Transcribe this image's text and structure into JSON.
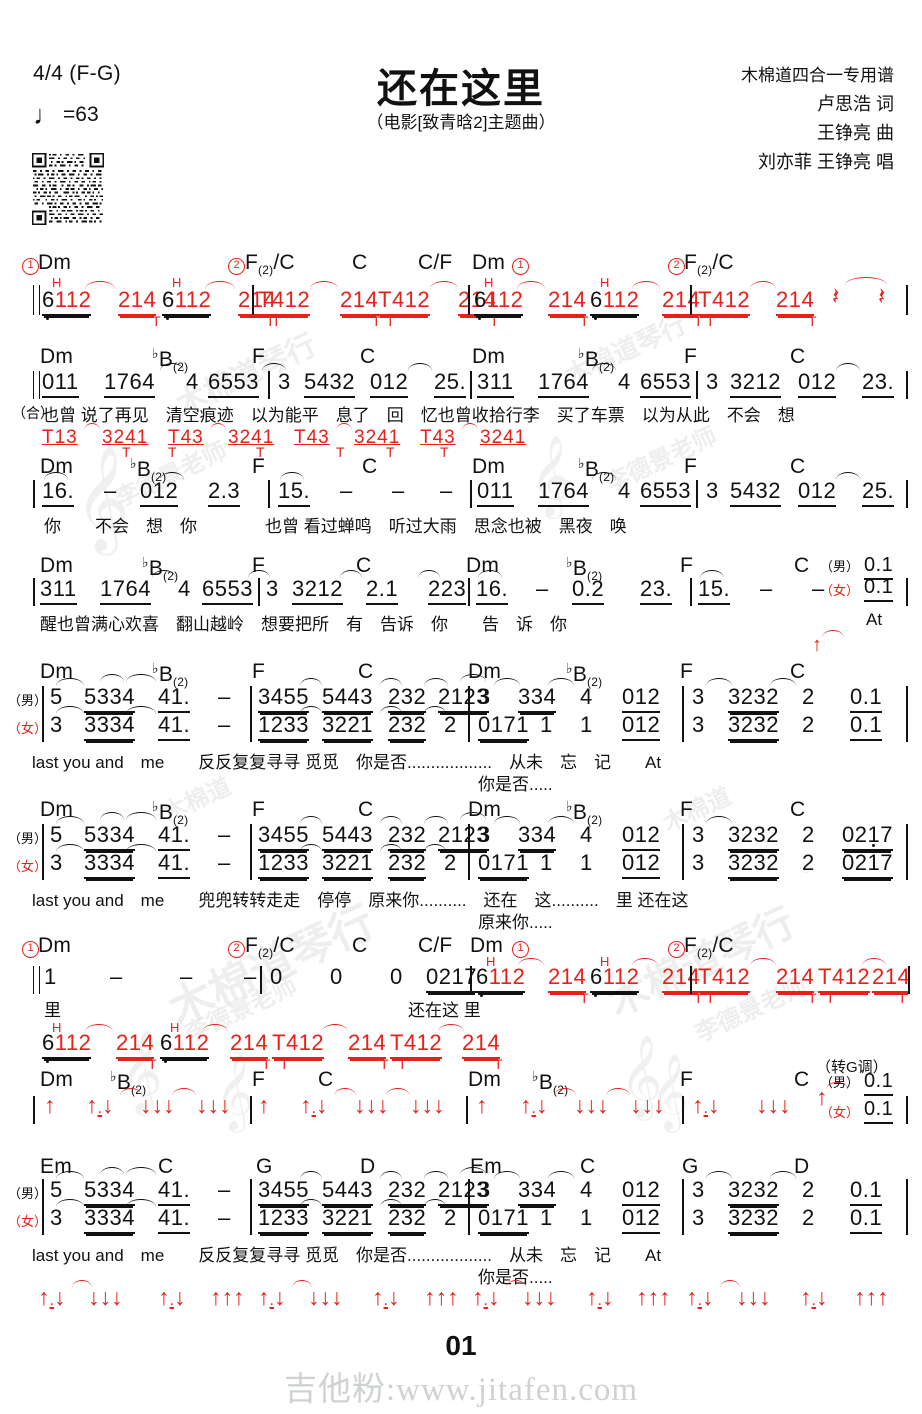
{
  "header": {
    "meter": "4/4 (F-G)",
    "tempo_note": "♩",
    "tempo": "=63",
    "title": "还在这里",
    "subtitle": "（电影[致青晗2]主题曲）",
    "publisher": "木棉道四合一专用谱",
    "lyricist": "卢思浩 词",
    "composer": "王铮亮 曲",
    "singers": "刘亦菲 王铮亮 唱",
    "qr_name": "qr-code"
  },
  "colors": {
    "red": "#e8201a",
    "black": "#111111",
    "watermark": "#d8dcd8"
  },
  "page_number": "01",
  "site_watermark": "吉他粉:www.jitafen.com",
  "watermarks": [
    "木棉道琴行",
    "李德景老师"
  ],
  "labels": {
    "male": "（男）",
    "female": "（女）",
    "together": "（合）",
    "modulate": "（转G调）",
    "ending1": "1",
    "ending2": "2"
  },
  "systems": [
    {
      "id": "intro-1",
      "kind": "tab",
      "chords": [
        "Dm",
        "F(2)/C",
        "C",
        "C/F",
        "Dm",
        "F(2)/C"
      ],
      "tab_cells": [
        "6112",
        "214",
        "6112",
        "214",
        "T412",
        "214",
        "T412",
        "214",
        "6112",
        "214",
        "6112",
        "214",
        "T412",
        "214"
      ],
      "thumb_marks": [
        "T"
      ],
      "hammer_marks": [
        "H"
      ],
      "rests": [
        "⸺",
        "⸺"
      ]
    },
    {
      "id": "verse-1",
      "kind": "melody",
      "chords": [
        "Dm",
        "♭B(2)",
        "F",
        "C",
        "Dm",
        "♭B(2)",
        "F",
        "C"
      ],
      "notes": [
        "011",
        "1764",
        "4",
        "6553",
        "3",
        "5432",
        "012",
        "25.",
        "311",
        "1764",
        "4",
        "6553",
        "3",
        "3212",
        "012",
        "23."
      ],
      "lyrics": "也曾 说了再见　清空痕迹　以为能平　息了　回　忆也曾收拾行李　买了车票　以为从此　不会　想",
      "lyric_prefix": "（合）",
      "fingering": [
        "T13",
        "3241",
        "T43",
        "3241",
        "T43",
        "3241",
        "T43",
        "3241"
      ]
    },
    {
      "id": "verse-2",
      "kind": "melody",
      "chords": [
        "Dm",
        "♭B(2)",
        "F",
        "C",
        "Dm",
        "♭B(2)",
        "F",
        "C"
      ],
      "notes": [
        "16.",
        "–",
        "012",
        "2.3",
        "15.",
        "–",
        "–",
        "–",
        "011",
        "1764",
        "4",
        "6553",
        "3",
        "5432",
        "012",
        "25."
      ],
      "lyrics": "你　　不会　想　你　　　　也曾 看过蝉鸣　听过大雨　思念也被　黑夜　唤"
    },
    {
      "id": "verse-3",
      "kind": "melody",
      "chords": [
        "Dm",
        "♭B(2)",
        "F",
        "C",
        "Dm",
        "♭B(2)",
        "F",
        "C"
      ],
      "notes": [
        "311",
        "1764",
        "4",
        "6553",
        "3",
        "3212",
        "2.1",
        "223",
        "16.",
        "–",
        "0.2",
        "23.",
        "15.",
        "–",
        "–",
        "0.1"
      ],
      "lyrics": "醒也曾满心欢喜　翻山越岭　想要把所　有　告诉　你　　告　诉　你",
      "male_tail": "0.1",
      "female_tail": "0.1",
      "tail_lyric": "At"
    },
    {
      "id": "chorus-1",
      "kind": "duet",
      "chords": [
        "Dm",
        "♭B(2)",
        "F",
        "C",
        "Dm",
        "♭B(2)",
        "F",
        "C"
      ],
      "male": [
        "5",
        "5334",
        "41.",
        "–",
        "3455",
        "5443",
        "232",
        "2123",
        "3",
        "334",
        "4",
        "012",
        "3",
        "3232",
        "2",
        "0.1"
      ],
      "female": [
        "3",
        "3334",
        "41.",
        "–",
        "1233",
        "3221",
        "232",
        "2",
        "0171",
        "1",
        "1",
        "012",
        "3",
        "3232",
        "2",
        "0.1"
      ],
      "lyrics": "last  you and　me　　反反复复寻寻 觅觅　你是否..................　从未　忘　记　　At",
      "lyrics2": "你是否....."
    },
    {
      "id": "chorus-2",
      "kind": "duet",
      "chords": [
        "Dm",
        "♭B(2)",
        "F",
        "C",
        "Dm",
        "♭B(2)",
        "F",
        "C"
      ],
      "male": [
        "5",
        "5334",
        "41.",
        "–",
        "3455",
        "5443",
        "232",
        "2123",
        "3",
        "334",
        "4",
        "012",
        "3",
        "3232",
        "2",
        "0217"
      ],
      "female": [
        "3",
        "3334",
        "41.",
        "–",
        "1233",
        "3221",
        "232",
        "2",
        "0171",
        "1",
        "1",
        "012",
        "3",
        "3232",
        "2",
        "0217"
      ],
      "lyrics": "last  you and　me　　兜兜转转走走　停停　原来你..........　还在　这..........　里 还在这",
      "lyrics2": "原来你....."
    },
    {
      "id": "interlude",
      "kind": "tab",
      "chords": [
        "Dm",
        "F(2)/C",
        "C",
        "C/F",
        "Dm",
        "F(2)/C"
      ],
      "notes": [
        "1",
        "–",
        "–",
        "–",
        "0",
        "0",
        "0",
        "0217"
      ],
      "lyrics": "里",
      "lyrics_tail": "还在这 里",
      "tab_cells": [
        "6112",
        "214",
        "6112",
        "214",
        "T412",
        "214",
        "T412",
        "214"
      ]
    },
    {
      "id": "interlude-2",
      "kind": "tab",
      "tab_cells": [
        "6112",
        "214",
        "6112",
        "214",
        "T412",
        "214",
        "T412",
        "214"
      ]
    },
    {
      "id": "strum-1",
      "kind": "strum",
      "chords": [
        "Dm",
        "♭B(2)",
        "F",
        "C",
        "Dm",
        "♭B(2)",
        "F",
        "C"
      ],
      "male_tail": "0.1",
      "female_tail": "0.1",
      "modulate": "（转G调）"
    },
    {
      "id": "chorus-3",
      "kind": "duet",
      "chords": [
        "Em",
        "C",
        "G",
        "D",
        "Em",
        "C",
        "G",
        "D"
      ],
      "male": [
        "5",
        "5334",
        "41.",
        "–",
        "3455",
        "5443",
        "232",
        "2123",
        "3",
        "334",
        "4",
        "012",
        "3",
        "3232",
        "2",
        "0.1"
      ],
      "female": [
        "3",
        "3334",
        "41.",
        "–",
        "1233",
        "3221",
        "232",
        "2",
        "0171",
        "1",
        "1",
        "012",
        "3",
        "3232",
        "2",
        "0.1"
      ],
      "lyrics": "last  you and　me　　反反复复寻寻 觅觅　你是否..................　从未　忘　记　　At",
      "lyrics2": "你是否....."
    },
    {
      "id": "strum-2",
      "kind": "strum"
    }
  ]
}
